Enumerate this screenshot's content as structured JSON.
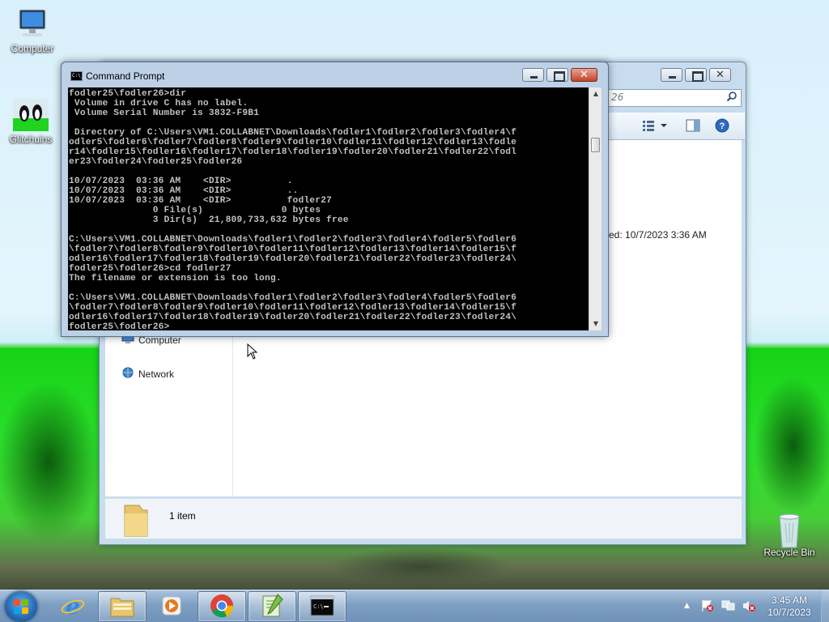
{
  "desktop": {
    "icons": [
      {
        "label": "Computer"
      },
      {
        "label": "Glitchuins"
      },
      {
        "label": "Recycle Bin"
      }
    ]
  },
  "explorer": {
    "search_placeholder": "26",
    "nav": {
      "computer": "Computer",
      "network": "Network"
    },
    "details": "ed: 10/7/2023 3:36 AM",
    "status": "1 item"
  },
  "cmd": {
    "title": "Command Prompt",
    "lines": [
      "fodler25\\fodler26>dir",
      " Volume in drive C has no label.",
      " Volume Serial Number is 3832-F9B1",
      "",
      " Directory of C:\\Users\\VM1.COLLABNET\\Downloads\\fodler1\\fodler2\\fodler3\\fodler4\\f",
      "odler5\\fodler6\\fodler7\\fodler8\\fodler9\\fodler10\\fodler11\\fodler12\\fodler13\\fodle",
      "r14\\fodler15\\fodler16\\fodler17\\fodler18\\fodler19\\fodler20\\fodler21\\fodler22\\fodl",
      "er23\\fodler24\\fodler25\\fodler26",
      "",
      "10/07/2023  03:36 AM    <DIR>          .",
      "10/07/2023  03:36 AM    <DIR>          ..",
      "10/07/2023  03:36 AM    <DIR>          fodler27",
      "               0 File(s)              0 bytes",
      "               3 Dir(s)  21,809,733,632 bytes free",
      "",
      "C:\\Users\\VM1.COLLABNET\\Downloads\\fodler1\\fodler2\\fodler3\\fodler4\\fodler5\\fodler6",
      "\\fodler7\\fodler8\\fodler9\\fodler10\\fodler11\\fodler12\\fodler13\\fodler14\\fodler15\\f",
      "odler16\\fodler17\\fodler18\\fodler19\\fodler20\\fodler21\\fodler22\\fodler23\\fodler24\\",
      "fodler25\\fodler26>cd fodler27",
      "The filename or extension is too long.",
      "",
      "C:\\Users\\VM1.COLLABNET\\Downloads\\fodler1\\fodler2\\fodler3\\fodler4\\fodler5\\fodler6",
      "\\fodler7\\fodler8\\fodler9\\fodler10\\fodler11\\fodler12\\fodler13\\fodler14\\fodler15\\f",
      "odler16\\fodler17\\fodler18\\fodler19\\fodler20\\fodler21\\fodler22\\fodler23\\fodler24\\",
      "fodler25\\fodler26>"
    ]
  },
  "taskbar": {
    "apps": [
      {
        "icon": "internet-explorer-icon"
      },
      {
        "icon": "file-explorer-icon"
      },
      {
        "icon": "media-player-icon"
      },
      {
        "icon": "chrome-icon"
      },
      {
        "icon": "notepad-plus-plus-icon"
      },
      {
        "icon": "command-prompt-icon"
      }
    ],
    "time": "3:45 AM",
    "date": "10/7/2023"
  }
}
